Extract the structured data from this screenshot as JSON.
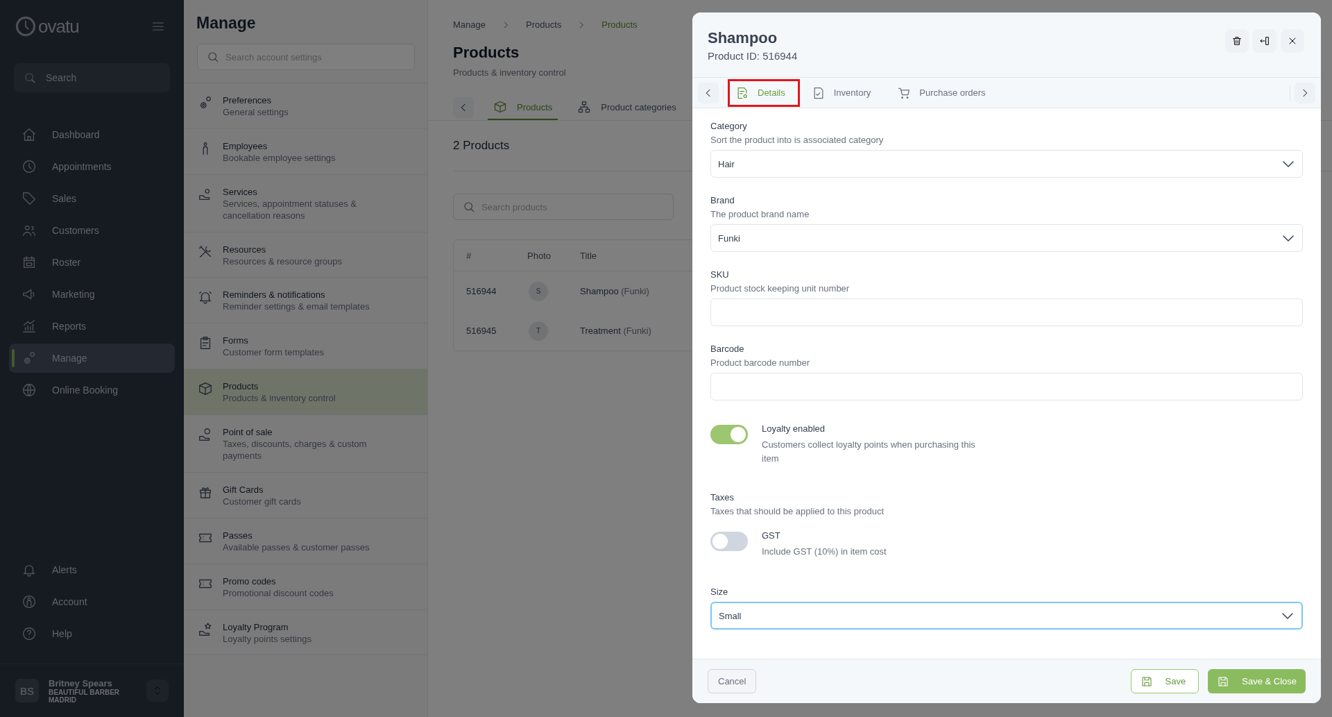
{
  "sidebar": {
    "logo": "ovatu",
    "search_placeholder": "Search",
    "nav": [
      {
        "label": "Dashboard",
        "selected": false
      },
      {
        "label": "Appointments",
        "selected": false
      },
      {
        "label": "Sales",
        "selected": false
      },
      {
        "label": "Customers",
        "selected": false
      },
      {
        "label": "Roster",
        "selected": false
      },
      {
        "label": "Marketing",
        "selected": false
      },
      {
        "label": "Reports",
        "selected": false
      },
      {
        "label": "Manage",
        "selected": true
      },
      {
        "label": "Online Booking",
        "selected": false
      }
    ],
    "bottom_nav": [
      {
        "label": "Alerts",
        "selected": false
      },
      {
        "label": "Account",
        "selected": false
      },
      {
        "label": "Help",
        "selected": false
      }
    ],
    "user": {
      "initials": "BS",
      "name": "Britney Spears",
      "business": "BEAUTIFUL BARBER MADRID"
    }
  },
  "settings_panel": {
    "title": "Manage",
    "search_placeholder": "Search account settings",
    "items": [
      {
        "title": "Preferences",
        "description": "General settings",
        "selected": false
      },
      {
        "title": "Employees",
        "description": "Bookable employee settings",
        "selected": false
      },
      {
        "title": "Services",
        "description": "Services, appointment statuses & cancellation reasons",
        "selected": false
      },
      {
        "title": "Resources",
        "description": "Resources & resource groups",
        "selected": false
      },
      {
        "title": "Reminders & notifications",
        "description": "Reminder settings & email templates",
        "selected": false
      },
      {
        "title": "Forms",
        "description": "Customer form templates",
        "selected": false
      },
      {
        "title": "Products",
        "description": "Products & inventory control",
        "selected": true
      },
      {
        "title": "Point of sale",
        "description": "Taxes, discounts, charges & custom payments",
        "selected": false
      },
      {
        "title": "Gift Cards",
        "description": "Customer gift cards",
        "selected": false
      },
      {
        "title": "Passes",
        "description": "Available passes & customer passes",
        "selected": false
      },
      {
        "title": "Promo codes",
        "description": "Promotional discount codes",
        "selected": false
      },
      {
        "title": "Loyalty Program",
        "description": "Loyalty points settings",
        "selected": false
      }
    ]
  },
  "main": {
    "breadcrumbs": [
      {
        "label": "Manage",
        "selected": false
      },
      {
        "label": "Products",
        "selected": false
      },
      {
        "label": "Products",
        "selected": true
      }
    ],
    "title": "Products",
    "subtitle": "Products & inventory control",
    "tabs": [
      {
        "label": "Products",
        "selected": true
      },
      {
        "label": "Product categories",
        "selected": false
      }
    ],
    "count": "2 Products",
    "search_placeholder": "Search products",
    "table": {
      "columns": [
        "#",
        "Photo",
        "Title"
      ],
      "rows": [
        {
          "id": "516944",
          "photo_initial": "S",
          "title": "Shampoo",
          "brand": "(Funki)"
        },
        {
          "id": "516945",
          "photo_initial": "T",
          "title": "Treatment",
          "brand": "(Funki)"
        }
      ]
    }
  },
  "modal": {
    "title": "Shampoo",
    "subtitle": "Product ID: 516944",
    "tabs": [
      {
        "label": "Details",
        "selected": true,
        "highlighted": true
      },
      {
        "label": "Inventory",
        "selected": false,
        "highlighted": false
      },
      {
        "label": "Purchase orders",
        "selected": false,
        "highlighted": false
      }
    ],
    "fields": [
      {
        "kind": "select",
        "label": "Category",
        "description": "Sort the product into is associated category",
        "value": "Hair",
        "focused": false
      },
      {
        "kind": "select",
        "label": "Brand",
        "description": "The product brand name",
        "value": "Funki",
        "focused": false
      },
      {
        "kind": "input",
        "label": "SKU",
        "description": "Product stock keeping unit number"
      },
      {
        "kind": "input",
        "label": "Barcode",
        "description": "Product barcode number"
      },
      {
        "kind": "toggle",
        "label": "Loyalty enabled",
        "description": "Customers collect loyalty points when purchasing this item",
        "on": true
      },
      {
        "kind": "group",
        "label": "Taxes",
        "description": "Taxes that should be applied to this product",
        "toggles": [
          {
            "label": "GST",
            "description": "Include GST (10%) in item cost",
            "on": false
          }
        ]
      },
      {
        "kind": "select",
        "label": "Size",
        "value": "Small",
        "focused": true
      }
    ],
    "buttons": {
      "cancel": "Cancel",
      "save": "Save",
      "save_close": "Save & Close"
    }
  }
}
